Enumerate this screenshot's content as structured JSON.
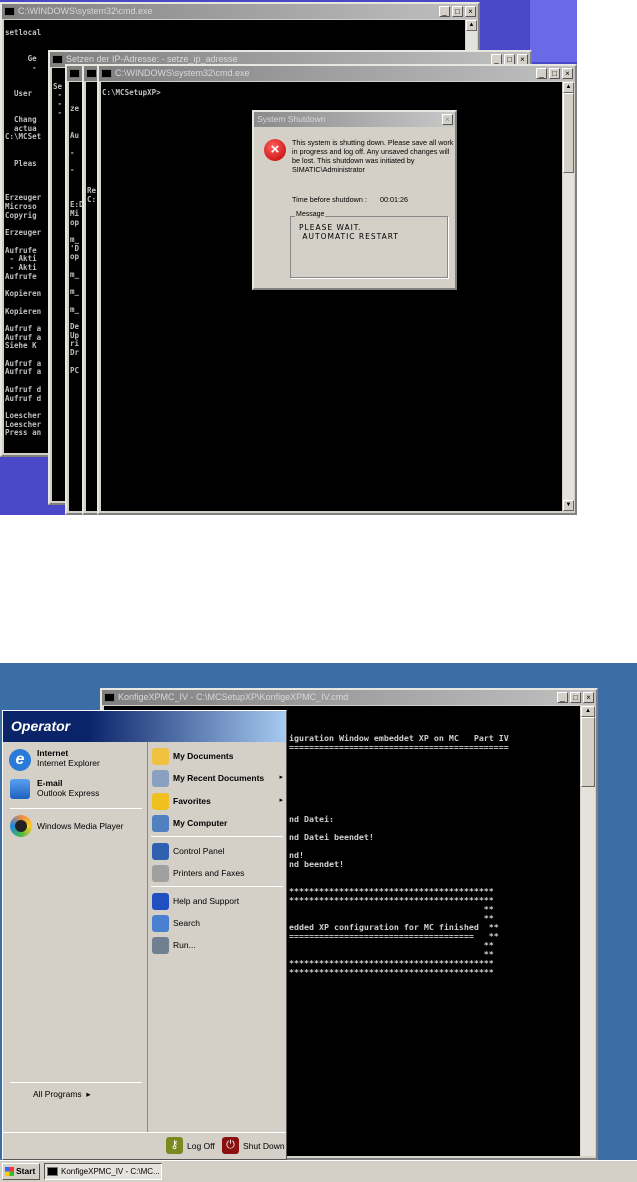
{
  "top_screenshot": {
    "colors": {
      "desktop": "#4a48c8",
      "desktop_light": "#6a6ae8",
      "console": "#000000"
    },
    "win1": {
      "title": "C:\\WINDOWS\\system32\\cmd.exe",
      "text": "setlocal\n\n\n     Ge\n      -\n\n\n  User\n\n\n  Chang\n  actua\nC:\\MCSet\n\n\n  Pleas\n\n\n\nErzeuger\nMicroso\nCopyrig\n\nErzeuger\n\nAufrufe\n - Akti\n - Akti\nAufrufe\n\nKopieren\n\nKopieren\n\nAufruf a\nAufruf a\nSiehe K\n\nAufruf a\nAufruf a\n\nAufruf d\nAufruf d\n\nLoescher\nLoescher\nPress an"
    },
    "win2": {
      "title": "Setzen der IP-Adresse: - setze_ip_adresse",
      "text": "\nSe\n -\n -\n -"
    },
    "win3": {
      "text": "\n\nze\n\n\nAu\n\n-\n\n-\n\n\n\nE:D\nMi\nop\n\nm_\n'D\nop\n\nm_\n\nm_\n\nm_\n\nDe\nUp\nri\nDr\n\nPC"
    },
    "win4": {
      "text": "\n\n\n\n\n\n\n\n\n\nRe\nC:"
    },
    "win5": {
      "title": "C:\\WINDOWS\\system32\\cmd.exe",
      "text": "C:\\MCSetupXP>"
    },
    "dialog": {
      "title": "System Shutdown",
      "message": "This system is shutting down. Please save all work in progress and log off. Any unsaved changes will be lost. This shutdown was initiated by SIMATIC\\Administrator",
      "time_label": "Time before shutdown :",
      "time_value": "00:01:26",
      "group_label": "Message",
      "group_text": "PLEASE WAIT.\n AUTOMATIC RESTART"
    }
  },
  "bottom_screenshot": {
    "colors": {
      "desktop": "#3a6ea5",
      "menu_header": "#0a246a",
      "menu_bg": "#d4d0c8"
    },
    "cmd": {
      "title": "KonfigeXPMC_IV - C:\\MCSetupXP\\KonfigeXPMC_IV.cmd",
      "text": "iguration Window embeddet XP on MC   Part IV\n============================================\n\n\n\n\n\n\n\nnd Datei:\n\nnd Datei beendet!\n\nnd!\nnd beendet!\n\n\n*****************************************\n*****************************************\n                                       **\n                                       **\nedded XP configuration for MC finished  **\n=====================================   **\n                                       **\n                                       **\n*****************************************\n*****************************************"
    },
    "start_menu": {
      "user": "Operator",
      "pinned": [
        {
          "title": "Internet",
          "sub": "Internet Explorer",
          "icon": "internet-explorer-icon"
        },
        {
          "title": "E-mail",
          "sub": "Outlook Express",
          "icon": "outlook-express-icon"
        }
      ],
      "recent": [
        {
          "title": "Windows Media Player",
          "icon": "media-player-icon"
        }
      ],
      "all_programs": "All Programs",
      "right": [
        {
          "label": "My Documents",
          "bold": true
        },
        {
          "label": "My Recent Documents",
          "bold": true,
          "arrow": true
        },
        {
          "label": "Favorites",
          "bold": true,
          "arrow": true
        },
        {
          "label": "My Computer",
          "bold": true
        },
        {
          "label": "Control Panel"
        },
        {
          "label": "Printers and Faxes"
        },
        {
          "label": "Help and Support"
        },
        {
          "label": "Search"
        },
        {
          "label": "Run..."
        }
      ],
      "log_off": "Log Off",
      "shut_down": "Shut Down"
    },
    "taskbar": {
      "start": "Start",
      "task": "KonfigeXPMC_IV - C:\\MC..."
    }
  }
}
